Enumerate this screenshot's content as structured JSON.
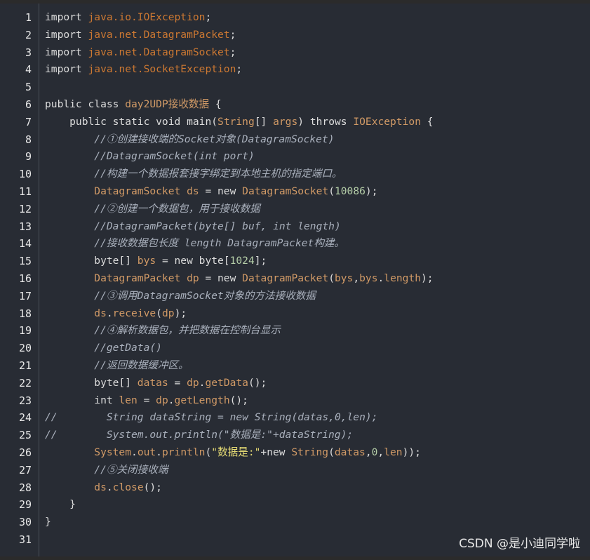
{
  "line_numbers": [
    "1",
    "2",
    "3",
    "4",
    "5",
    "6",
    "7",
    "8",
    "9",
    "10",
    "11",
    "12",
    "13",
    "14",
    "15",
    "16",
    "17",
    "18",
    "19",
    "20",
    "21",
    "22",
    "23",
    "24",
    "25",
    "26",
    "27",
    "28",
    "29",
    "30",
    "31"
  ],
  "code": {
    "l1": [
      [
        "k",
        "import "
      ],
      [
        "p",
        "java.io.IOException"
      ],
      [
        "k",
        ";"
      ]
    ],
    "l2": [
      [
        "k",
        "import "
      ],
      [
        "p",
        "java.net.DatagramPacket"
      ],
      [
        "k",
        ";"
      ]
    ],
    "l3": [
      [
        "k",
        "import "
      ],
      [
        "p",
        "java.net.DatagramSocket"
      ],
      [
        "k",
        ";"
      ]
    ],
    "l4": [
      [
        "k",
        "import "
      ],
      [
        "p",
        "java.net.SocketException"
      ],
      [
        "k",
        ";"
      ]
    ],
    "l5": [],
    "l6": [
      [
        "k",
        "public class "
      ],
      [
        "n",
        "day2UDP接收数据"
      ],
      [
        "k",
        " {"
      ]
    ],
    "l7": [
      [
        "k",
        "    public static void "
      ],
      [
        "k",
        "main("
      ],
      [
        "n",
        "String"
      ],
      [
        "k",
        "[] "
      ],
      [
        "n",
        "args"
      ],
      [
        "k",
        ") throws "
      ],
      [
        "n",
        "IOException"
      ],
      [
        "k",
        " {"
      ]
    ],
    "l8": [
      [
        "c",
        "        //①创建接收端的Socket对象(DatagramSocket)"
      ]
    ],
    "l9": [
      [
        "c",
        "        //DatagramSocket(int port)"
      ]
    ],
    "l10": [
      [
        "c",
        "        //构建一个数据报套接字绑定到本地主机的指定端口。"
      ]
    ],
    "l11": [
      [
        "n",
        "        DatagramSocket ds"
      ],
      [
        "k",
        " = new "
      ],
      [
        "n",
        "DatagramSocket"
      ],
      [
        "k",
        "("
      ],
      [
        "num",
        "10086"
      ],
      [
        "k",
        ");"
      ]
    ],
    "l12": [
      [
        "c",
        "        //②创建一个数据包，用于接收数据"
      ]
    ],
    "l13": [
      [
        "c",
        "        //DatagramPacket(byte[] buf, int length)"
      ]
    ],
    "l14": [
      [
        "c",
        "        //接收数据包长度 length DatagramPacket构建。"
      ]
    ],
    "l15": [
      [
        "k",
        "        byte[] "
      ],
      [
        "n",
        "bys"
      ],
      [
        "k",
        " = new byte["
      ],
      [
        "num",
        "1024"
      ],
      [
        "k",
        "];"
      ]
    ],
    "l16": [
      [
        "n",
        "        DatagramPacket dp"
      ],
      [
        "k",
        " = new "
      ],
      [
        "n",
        "DatagramPacket"
      ],
      [
        "k",
        "("
      ],
      [
        "n",
        "bys"
      ],
      [
        "k",
        ","
      ],
      [
        "n",
        "bys"
      ],
      [
        "k",
        "."
      ],
      [
        "n",
        "length"
      ],
      [
        "k",
        ");"
      ]
    ],
    "l17": [
      [
        "c",
        "        //③调用DatagramSocket对象的方法接收数据"
      ]
    ],
    "l18": [
      [
        "n",
        "        ds"
      ],
      [
        "k",
        "."
      ],
      [
        "n",
        "receive"
      ],
      [
        "k",
        "("
      ],
      [
        "n",
        "dp"
      ],
      [
        "k",
        ");"
      ]
    ],
    "l19": [
      [
        "c",
        "        //④解析数据包，并把数据在控制台显示"
      ]
    ],
    "l20": [
      [
        "c",
        "        //getData()"
      ]
    ],
    "l21": [
      [
        "c",
        "        //返回数据缓冲区。"
      ]
    ],
    "l22": [
      [
        "k",
        "        byte[] "
      ],
      [
        "n",
        "datas"
      ],
      [
        "k",
        " = "
      ],
      [
        "n",
        "dp"
      ],
      [
        "k",
        "."
      ],
      [
        "n",
        "getData"
      ],
      [
        "k",
        "();"
      ]
    ],
    "l23": [
      [
        "k",
        "        int "
      ],
      [
        "n",
        "len"
      ],
      [
        "k",
        " = "
      ],
      [
        "n",
        "dp"
      ],
      [
        "k",
        "."
      ],
      [
        "n",
        "getLength"
      ],
      [
        "k",
        "();"
      ]
    ],
    "l24": [
      [
        "c",
        "//        String dataString = new String(datas,0,len);"
      ]
    ],
    "l25": [
      [
        "c",
        "//        System.out.println(\"数据是:\"+dataString);"
      ]
    ],
    "l26": [
      [
        "n",
        "        System"
      ],
      [
        "k",
        "."
      ],
      [
        "n",
        "out"
      ],
      [
        "k",
        "."
      ],
      [
        "n",
        "println"
      ],
      [
        "k",
        "("
      ],
      [
        "str",
        "\"数据是:\""
      ],
      [
        "k",
        "+new "
      ],
      [
        "n",
        "String"
      ],
      [
        "k",
        "("
      ],
      [
        "n",
        "datas"
      ],
      [
        "k",
        ","
      ],
      [
        "num",
        "0"
      ],
      [
        "k",
        ","
      ],
      [
        "n",
        "len"
      ],
      [
        "k",
        "));"
      ]
    ],
    "l27": [
      [
        "c",
        "        //⑤关闭接收端"
      ]
    ],
    "l28": [
      [
        "n",
        "        ds"
      ],
      [
        "k",
        "."
      ],
      [
        "n",
        "close"
      ],
      [
        "k",
        "();"
      ]
    ],
    "l29": [
      [
        "k",
        "    }"
      ]
    ],
    "l30": [
      [
        "k",
        "}"
      ]
    ],
    "l31": []
  },
  "watermark": "CSDN @是小迪同学啦",
  "colors": {
    "background": "#282c34",
    "keyword": "#dcdcdc",
    "identifier": "#d19a66",
    "package": "#cc7832",
    "number": "#b5cea8",
    "string": "#e6db74",
    "comment": "#a9b0bc"
  }
}
